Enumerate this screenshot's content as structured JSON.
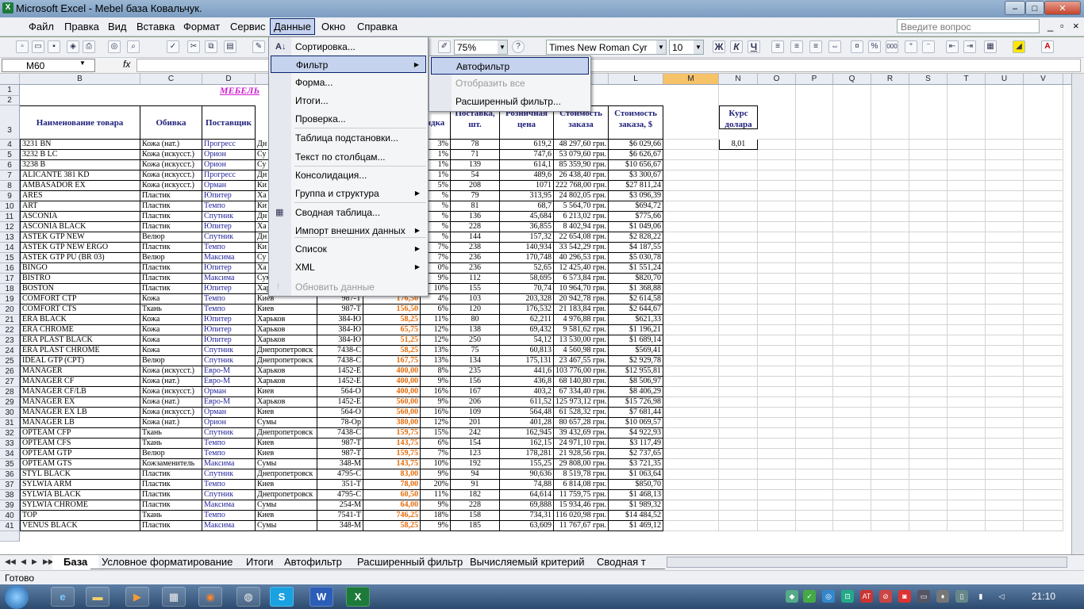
{
  "window": {
    "title": "Microsoft Excel - Mebel база Ковальчук."
  },
  "menubar": {
    "items": [
      "Файл",
      "Правка",
      "Вид",
      "Вставка",
      "Формат",
      "Сервис",
      "Данные",
      "Окно",
      "Справка"
    ],
    "help_placeholder": "Введите вопрос"
  },
  "toolbar": {
    "zoom": "75%",
    "font": "Times New Roman Cyr",
    "size": "10",
    "bold": "Ж",
    "italic": "К",
    "underline": "Ч"
  },
  "formula": {
    "name_box": "M60",
    "fx": "fx",
    "content": ""
  },
  "columns": [
    "B",
    "C",
    "D",
    "E",
    "F",
    "G",
    "H",
    "I",
    "J",
    "K",
    "L",
    "M",
    "N",
    "O",
    "P",
    "Q",
    "R",
    "S",
    "T",
    "U",
    "V"
  ],
  "sheet": {
    "title": "МЕБЕЛЬ",
    "headers": {
      "b": "Наименование товара",
      "c": "Обивка",
      "d": "Поставщик",
      "h": "ндка",
      "i": "Поставка, шт.",
      "j": "Розничная цена",
      "k": "Стоимость заказа",
      "l": "Стоимость заказа, $"
    },
    "kurs": {
      "label": "Курс долара",
      "value": "8,01"
    },
    "rows": [
      {
        "n": "4",
        "b": "3231 BN",
        "c": "Кожа (нат.)",
        "d": "Прогресс",
        "e": "Дн",
        "f": "",
        "g": "",
        "h": "3%",
        "i": "78",
        "j": "619,2",
        "k": "48 297,60 грн.",
        "l": "$6 029,66"
      },
      {
        "n": "5",
        "b": "3232 B LC",
        "c": "Кожа (искусст.)",
        "d": "Орион",
        "e": "Су",
        "f": "",
        "g": "",
        "h": "1%",
        "i": "71",
        "j": "747,6",
        "k": "53 079,60 грн.",
        "l": "$6 626,67"
      },
      {
        "n": "6",
        "b": "3238 B",
        "c": "Кожа (искусст.)",
        "d": "Орион",
        "e": "Су",
        "f": "",
        "g": "",
        "h": "1%",
        "i": "139",
        "j": "614,1",
        "k": "85 359,90 грн.",
        "l": "$10 656,67"
      },
      {
        "n": "7",
        "b": "ALICANTE 381 KD",
        "c": "Кожа (искусст.)",
        "d": "Прогресс",
        "e": "Дн",
        "f": "",
        "g": "",
        "h": "1%",
        "i": "54",
        "j": "489,6",
        "k": "26 438,40 грн.",
        "l": "$3 300,67"
      },
      {
        "n": "8",
        "b": "AMBASADOR EX",
        "c": "Кожа (искусст.)",
        "d": "Орман",
        "e": "Ки",
        "f": "",
        "g": "",
        "h": "5%",
        "i": "208",
        "j": "1071",
        "k": "222 768,00 грн.",
        "l": "$27 811,24"
      },
      {
        "n": "9",
        "b": "ARES",
        "c": "Пластик",
        "d": "Юпитер",
        "e": "Ха",
        "f": "",
        "g": "",
        "h": "%",
        "i": "79",
        "j": "313,95",
        "k": "24 802,05 грн.",
        "l": "$3 096,39"
      },
      {
        "n": "10",
        "b": "ART",
        "c": "Пластик",
        "d": "Темпо",
        "e": "Ки",
        "f": "",
        "g": "",
        "h": "%",
        "i": "81",
        "j": "68,7",
        "k": "5 564,70 грн.",
        "l": "$694,72"
      },
      {
        "n": "11",
        "b": "ASCONIA",
        "c": "Пластик",
        "d": "Спутник",
        "e": "Дн",
        "f": "",
        "g": "",
        "h": "%",
        "i": "136",
        "j": "45,684",
        "k": "6 213,02 грн.",
        "l": "$775,66"
      },
      {
        "n": "12",
        "b": "ASCONIA BLACK",
        "c": "Пластик",
        "d": "Юпитер",
        "e": "Ха",
        "f": "",
        "g": "",
        "h": "%",
        "i": "228",
        "j": "36,855",
        "k": "8 402,94 грн.",
        "l": "$1 049,06"
      },
      {
        "n": "13",
        "b": "ASTEK GTP NEW",
        "c": "Велюр",
        "d": "Спутник",
        "e": "Дн",
        "f": "",
        "g": "",
        "h": "%",
        "i": "144",
        "j": "157,32",
        "k": "22 654,08 грн.",
        "l": "$2 828,22"
      },
      {
        "n": "14",
        "b": "ASTEK GTP NEW ERGO",
        "c": "Пластик",
        "d": "Темпо",
        "e": "Ки",
        "f": "",
        "g": "",
        "h": "7%",
        "i": "238",
        "j": "140,934",
        "k": "33 542,29 грн.",
        "l": "$4 187,55"
      },
      {
        "n": "15",
        "b": "ASTEK GTP PU (BR 03)",
        "c": "Велюр",
        "d": "Максима",
        "e": "Су",
        "f": "",
        "g": "",
        "h": "7%",
        "i": "236",
        "j": "170,748",
        "k": "40 296,53 грн.",
        "l": "$5 030,78"
      },
      {
        "n": "16",
        "b": "BINGO",
        "c": "Пластик",
        "d": "Юпитер",
        "e": "Ха",
        "f": "",
        "g": "",
        "h": "0%",
        "i": "236",
        "j": "52,65",
        "k": "12 425,40 грн.",
        "l": "$1 551,24"
      },
      {
        "n": "17",
        "b": "BISTRO",
        "c": "Пластик",
        "d": "Максима",
        "e": "Сумы",
        "f": "348-М",
        "g": "63,75",
        "h": "9%",
        "i": "112",
        "j": "58,695",
        "k": "6 573,84 грн.",
        "l": "$820,70"
      },
      {
        "n": "18",
        "b": "BOSTON",
        "c": "Пластик",
        "d": "Юпитер",
        "e": "Харьков",
        "f": "384-Ю",
        "g": "65,60",
        "h": "10%",
        "i": "155",
        "j": "70,74",
        "k": "10 964,70 грн.",
        "l": "$1 368,88"
      },
      {
        "n": "19",
        "b": "COMFORT CTP",
        "c": "Кожа",
        "d": "Темпо",
        "e": "Киев",
        "f": "987-Т",
        "g": "176,50",
        "h": "4%",
        "i": "103",
        "j": "203,328",
        "k": "20 942,78 грн.",
        "l": "$2 614,58"
      },
      {
        "n": "20",
        "b": "COMFORT CTS",
        "c": "Ткань",
        "d": "Темпо",
        "e": "Киев",
        "f": "987-Т",
        "g": "156,50",
        "h": "6%",
        "i": "120",
        "j": "176,532",
        "k": "21 183,84 грн.",
        "l": "$2 644,67"
      },
      {
        "n": "21",
        "b": "ERA BLACK",
        "c": "Кожа",
        "d": "Юпитер",
        "e": "Харьков",
        "f": "384-Ю",
        "g": "58,25",
        "h": "11%",
        "i": "80",
        "j": "62,211",
        "k": "4 976,88 грн.",
        "l": "$621,33"
      },
      {
        "n": "22",
        "b": "ERA CHROME",
        "c": "Кожа",
        "d": "Юпитер",
        "e": "Харьков",
        "f": "384-Ю",
        "g": "65,75",
        "h": "12%",
        "i": "138",
        "j": "69,432",
        "k": "9 581,62 грн.",
        "l": "$1 196,21"
      },
      {
        "n": "23",
        "b": "ERA PLAST BLACK",
        "c": "Кожа",
        "d": "Юпитер",
        "e": "Харьков",
        "f": "384-Ю",
        "g": "51,25",
        "h": "12%",
        "i": "250",
        "j": "54,12",
        "k": "13 530,00 грн.",
        "l": "$1 689,14"
      },
      {
        "n": "24",
        "b": "ERA PLAST CHROME",
        "c": "Кожа",
        "d": "Спутник",
        "e": "Днепропетровск",
        "f": "7438-С",
        "g": "58,25",
        "h": "13%",
        "i": "75",
        "j": "60,813",
        "k": "4 560,98 грн.",
        "l": "$569,41"
      },
      {
        "n": "25",
        "b": "IDEAL GTP (CPT)",
        "c": "Велюр",
        "d": "Спутник",
        "e": "Днепропетровск",
        "f": "7438-С",
        "g": "167,75",
        "h": "13%",
        "i": "134",
        "j": "175,131",
        "k": "23 467,55 грн.",
        "l": "$2 929,78"
      },
      {
        "n": "26",
        "b": "MANAGER",
        "c": "Кожа (искусст.)",
        "d": "Евро-М",
        "e": "Харьков",
        "f": "1452-Е",
        "g": "400,00",
        "h": "8%",
        "i": "235",
        "j": "441,6",
        "k": "103 776,00 грн.",
        "l": "$12 955,81"
      },
      {
        "n": "27",
        "b": "MANAGER CF",
        "c": "Кожа (нат.)",
        "d": "Евро-М",
        "e": "Харьков",
        "f": "1452-Е",
        "g": "400,00",
        "h": "9%",
        "i": "156",
        "j": "436,8",
        "k": "68 140,80 грн.",
        "l": "$8 506,97"
      },
      {
        "n": "28",
        "b": "MANAGER CF/LB",
        "c": "Кожа (искусст.)",
        "d": "Орман",
        "e": "Киев",
        "f": "564-О",
        "g": "400,00",
        "h": "16%",
        "i": "167",
        "j": "403,2",
        "k": "67 334,40 грн.",
        "l": "$8 406,29"
      },
      {
        "n": "29",
        "b": "MANAGER EX",
        "c": "Кожа (нат.)",
        "d": "Евро-М",
        "e": "Харьков",
        "f": "1452-Е",
        "g": "560,00",
        "h": "9%",
        "i": "206",
        "j": "611,52",
        "k": "125 973,12 грн.",
        "l": "$15 726,98"
      },
      {
        "n": "30",
        "b": "MANAGER EX LB",
        "c": "Кожа (искусст.)",
        "d": "Орман",
        "e": "Киев",
        "f": "564-О",
        "g": "560,00",
        "h": "16%",
        "i": "109",
        "j": "564,48",
        "k": "61 528,32 грн.",
        "l": "$7 681,44"
      },
      {
        "n": "31",
        "b": "MANAGER LB",
        "c": "Кожа (нат.)",
        "d": "Орион",
        "e": "Сумы",
        "f": "78-Ор",
        "g": "380,00",
        "h": "12%",
        "i": "201",
        "j": "401,28",
        "k": "80 657,28 грн.",
        "l": "$10 069,57"
      },
      {
        "n": "32",
        "b": "OPTEAM CFP",
        "c": "Ткань",
        "d": "Спутник",
        "e": "Днепропетровск",
        "f": "7438-С",
        "g": "159,75",
        "h": "15%",
        "i": "242",
        "j": "162,945",
        "k": "39 432,69 грн.",
        "l": "$4 922,93"
      },
      {
        "n": "33",
        "b": "OPTEAM CFS",
        "c": "Ткань",
        "d": "Темпо",
        "e": "Киев",
        "f": "987-Т",
        "g": "143,75",
        "h": "6%",
        "i": "154",
        "j": "162,15",
        "k": "24 971,10 грн.",
        "l": "$3 117,49"
      },
      {
        "n": "34",
        "b": "OPTEAM GTP",
        "c": "Велюр",
        "d": "Темпо",
        "e": "Киев",
        "f": "987-Т",
        "g": "159,75",
        "h": "7%",
        "i": "123",
        "j": "178,281",
        "k": "21 928,56 грн.",
        "l": "$2 737,65"
      },
      {
        "n": "35",
        "b": "OPTEAM GTS",
        "c": "Кожзаменитель",
        "d": "Максима",
        "e": "Сумы",
        "f": "348-М",
        "g": "143,75",
        "h": "10%",
        "i": "192",
        "j": "155,25",
        "k": "29 808,00 грн.",
        "l": "$3 721,35"
      },
      {
        "n": "36",
        "b": "STYL BLACK",
        "c": "Пластик",
        "d": "Спутник",
        "e": "Днепропетровск",
        "f": "4795-С",
        "g": "83,00",
        "h": "9%",
        "i": "94",
        "j": "90,636",
        "k": "8 519,78 грн.",
        "l": "$1 063,64"
      },
      {
        "n": "37",
        "b": "SYLWIA ARM",
        "c": "Пластик",
        "d": "Темпо",
        "e": "Киев",
        "f": "351-Т",
        "g": "78,00",
        "h": "20%",
        "i": "91",
        "j": "74,88",
        "k": "6 814,08 грн.",
        "l": "$850,70"
      },
      {
        "n": "38",
        "b": "SYLWIA BLACK",
        "c": "Пластик",
        "d": "Спутник",
        "e": "Днепропетровск",
        "f": "4795-С",
        "g": "60,50",
        "h": "11%",
        "i": "182",
        "j": "64,614",
        "k": "11 759,75 грн.",
        "l": "$1 468,13"
      },
      {
        "n": "39",
        "b": "SYLWIA CHROME",
        "c": "Пластик",
        "d": "Максима",
        "e": "Сумы",
        "f": "254-М",
        "g": "64,00",
        "h": "9%",
        "i": "228",
        "j": "69,888",
        "k": "15 934,46 грн.",
        "l": "$1 989,32"
      },
      {
        "n": "40",
        "b": "TOP",
        "c": "Ткань",
        "d": "Темпо",
        "e": "Киев",
        "f": "7541-Т",
        "g": "746,25",
        "h": "18%",
        "i": "158",
        "j": "734,31",
        "k": "116 020,98 грн.",
        "l": "$14 484,52"
      },
      {
        "n": "41",
        "b": "VENUS BLACK",
        "c": "Пластик",
        "d": "Максима",
        "e": "Сумы",
        "f": "348-М",
        "g": "58,25",
        "h": "9%",
        "i": "185",
        "j": "63,609",
        "k": "11 767,67 грн.",
        "l": "$1 469,12"
      }
    ]
  },
  "data_menu": {
    "items": [
      {
        "label": "Сортировка...",
        "arrow": false
      },
      {
        "label": "Фильтр",
        "arrow": true,
        "highlighted": true
      },
      {
        "label": "Форма...",
        "arrow": false
      },
      {
        "label": "Итоги...",
        "arrow": false
      },
      {
        "label": "Проверка...",
        "arrow": false
      },
      {
        "label": "Таблица подстановки...",
        "arrow": false
      },
      {
        "label": "Текст по столбцам...",
        "arrow": false
      },
      {
        "label": "Консолидация...",
        "arrow": false
      },
      {
        "label": "Группа и структура",
        "arrow": true
      },
      {
        "label": "Сводная таблица...",
        "arrow": false
      },
      {
        "label": "Импорт внешних данных",
        "arrow": true
      },
      {
        "label": "Список",
        "arrow": true
      },
      {
        "label": "XML",
        "arrow": true
      },
      {
        "label": "Обновить данные",
        "arrow": false,
        "disabled": true
      }
    ]
  },
  "filter_menu": {
    "items": [
      {
        "label": "Автофильтр",
        "highlighted": true
      },
      {
        "label": "Отобразить все",
        "disabled": true
      },
      {
        "label": "Расширенный фильтр..."
      }
    ]
  },
  "sheet_tabs": [
    "База",
    "Условное форматирование",
    "Итоги",
    "Автофильтр",
    "Расширенный фильтр",
    "Вычисляемый критерий",
    "Сводная т"
  ],
  "status": {
    "text": "Готово"
  },
  "taskbar": {
    "clock": "21:10"
  }
}
